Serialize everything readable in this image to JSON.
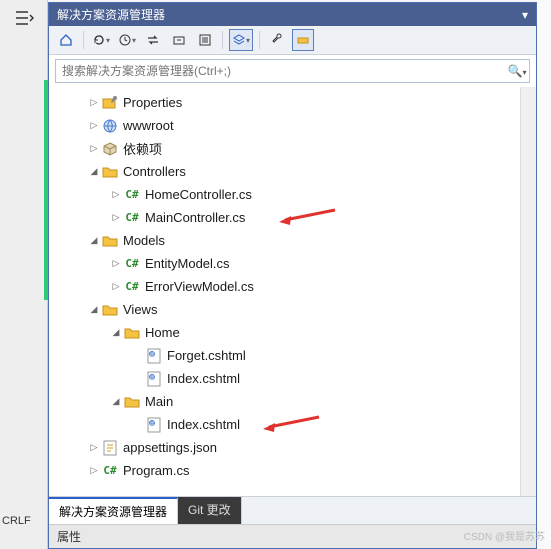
{
  "title": "解决方案资源管理器",
  "toolbar": {
    "home": "⌂",
    "refresh": "↻",
    "history": "⟳",
    "swap": "⇆",
    "collapse": "⊟",
    "props": "⊡",
    "view": "◇",
    "link": "⇱",
    "wrench": "🔧",
    "assoc": "⊟"
  },
  "search": {
    "placeholder": "搜索解决方案资源管理器(Ctrl+;)"
  },
  "tree": [
    {
      "depth": 1,
      "chev": "right",
      "icon": "wrench",
      "label": "Properties"
    },
    {
      "depth": 1,
      "chev": "right",
      "icon": "globe",
      "label": "wwwroot"
    },
    {
      "depth": 1,
      "chev": "right",
      "icon": "box",
      "label": "依赖项"
    },
    {
      "depth": 1,
      "chev": "down",
      "icon": "folder",
      "label": "Controllers"
    },
    {
      "depth": 2,
      "chev": "right",
      "icon": "cs",
      "label": "HomeController.cs"
    },
    {
      "depth": 2,
      "chev": "right",
      "icon": "cs",
      "label": "MainController.cs",
      "arrow": true
    },
    {
      "depth": 1,
      "chev": "down",
      "icon": "folder",
      "label": "Models"
    },
    {
      "depth": 2,
      "chev": "right",
      "icon": "cs",
      "label": "EntityModel.cs"
    },
    {
      "depth": 2,
      "chev": "right",
      "icon": "cs",
      "label": "ErrorViewModel.cs"
    },
    {
      "depth": 1,
      "chev": "down",
      "icon": "folder",
      "label": "Views"
    },
    {
      "depth": 2,
      "chev": "down",
      "icon": "folder",
      "label": "Home"
    },
    {
      "depth": 3,
      "chev": "none",
      "icon": "cshtml",
      "label": "Forget.cshtml"
    },
    {
      "depth": 3,
      "chev": "none",
      "icon": "cshtml",
      "label": "Index.cshtml"
    },
    {
      "depth": 2,
      "chev": "down",
      "icon": "folder",
      "label": "Main"
    },
    {
      "depth": 3,
      "chev": "none",
      "icon": "cshtml",
      "label": "Index.cshtml",
      "arrow": true
    },
    {
      "depth": 1,
      "chev": "right",
      "icon": "json",
      "label": "appsettings.json"
    },
    {
      "depth": 1,
      "chev": "right",
      "icon": "cs",
      "label": "Program.cs"
    }
  ],
  "tabs": {
    "active": "解决方案资源管理器",
    "git": "Git 更改"
  },
  "bottom": "属性",
  "crlf": "CRLF",
  "watermark": "CSDN @我是苏苏"
}
